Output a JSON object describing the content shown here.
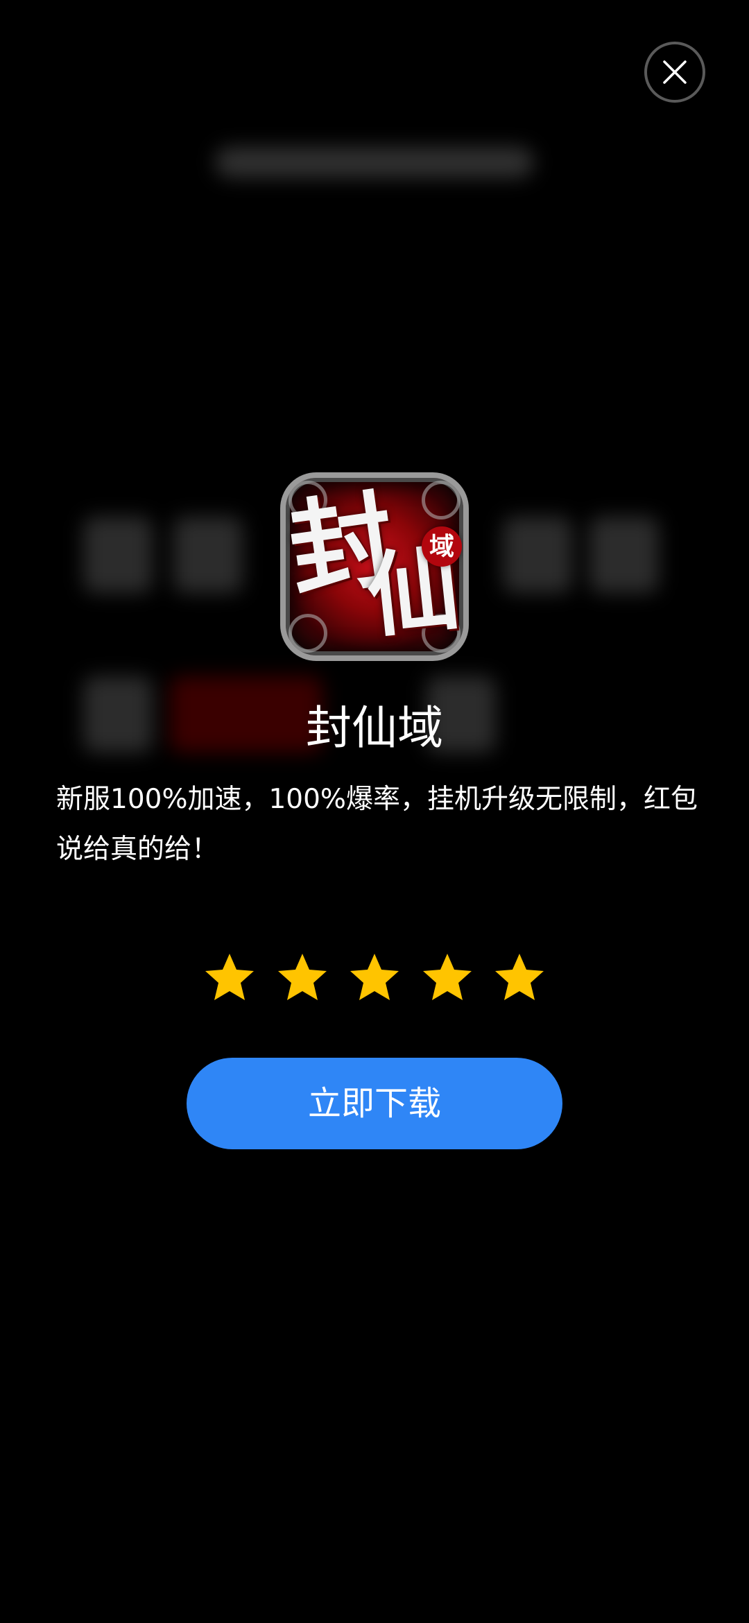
{
  "dialog": {
    "app_name": "封仙域",
    "description": "新服100%加速，100%爆率，挂机升级无限制，红包说给真的给！",
    "rating": 5,
    "rating_max": 5,
    "download_label": "立即下载",
    "accent_color": "#2f86f6",
    "star_color": "#ffc400"
  },
  "icons": {
    "close": "close-icon",
    "star": "star-icon"
  },
  "app_icon_art": {
    "char_1": "封",
    "char_2": "仙",
    "seal": "域"
  }
}
